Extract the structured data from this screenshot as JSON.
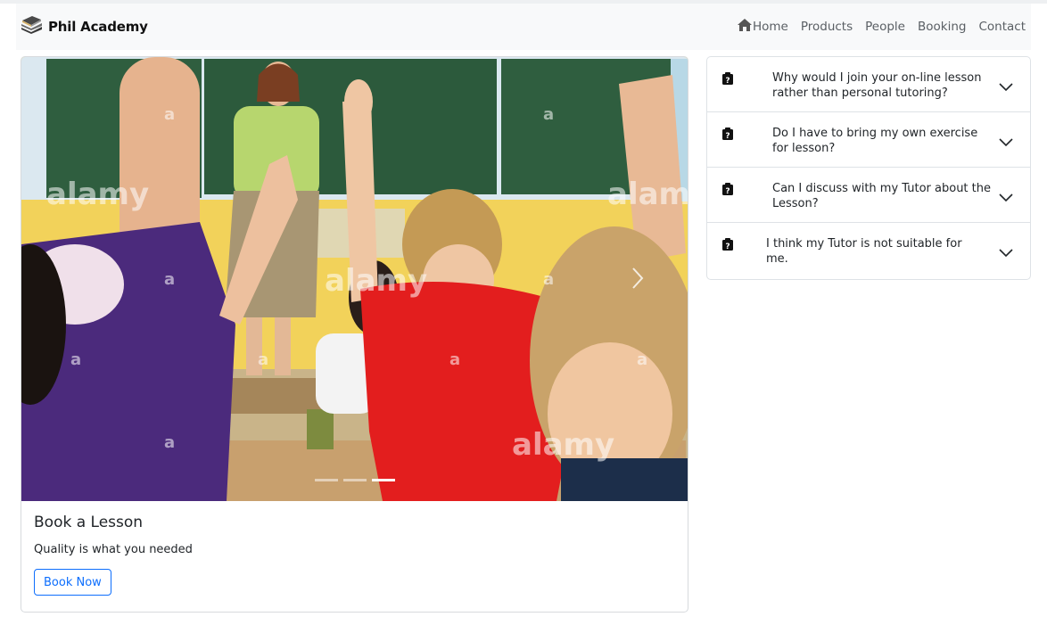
{
  "brand": {
    "name": "Phil Academy",
    "logo_icon": "books-icon"
  },
  "nav": {
    "items": [
      {
        "label": "Home",
        "icon": "home-icon"
      },
      {
        "label": "Products"
      },
      {
        "label": "People"
      },
      {
        "label": "Booking"
      },
      {
        "label": "Contact"
      }
    ]
  },
  "hero": {
    "watermark": "alamy",
    "image_description_icon": "classroom-photo",
    "next_icon": "chevron-right-icon",
    "indicators": 3,
    "active_indicator": 3
  },
  "card": {
    "title": "Book a Lesson",
    "text": "Quality is what you needed",
    "button_label": "Book Now"
  },
  "faq": {
    "items": [
      {
        "question": "Why would I join your on-line lesson rather than personal tutoring?"
      },
      {
        "question": "Do I have to bring my own exercise for lesson?"
      },
      {
        "question": "Can I discuss with my Tutor about the Lesson?"
      },
      {
        "question": "I think my Tutor is not suitable for me."
      }
    ]
  },
  "colors": {
    "accent": "#0d6efd",
    "navbar_bg": "#f8f9fa"
  }
}
